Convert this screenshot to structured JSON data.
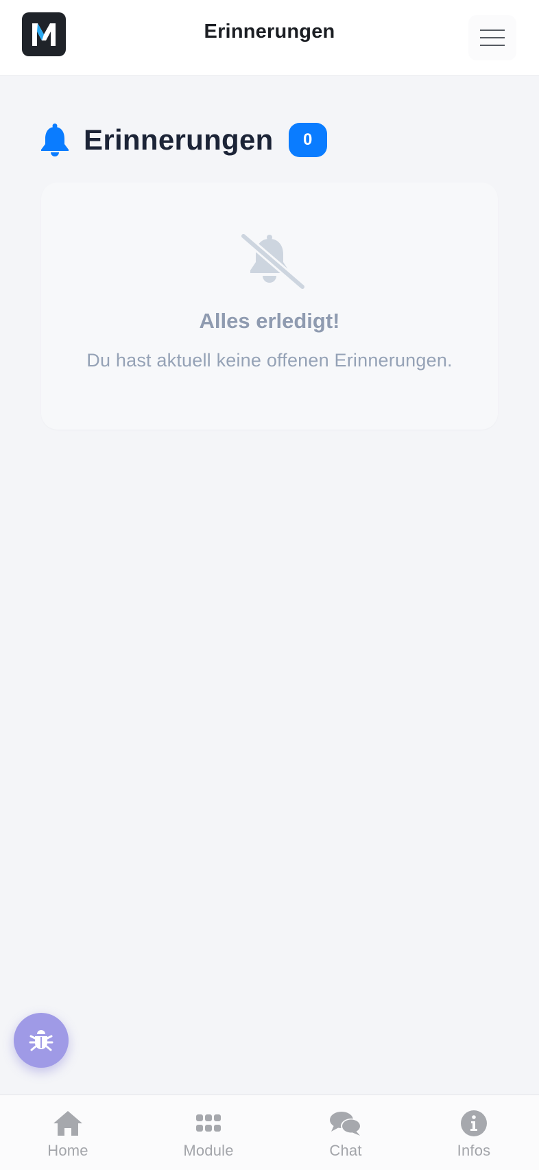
{
  "header": {
    "logo_letter": "M",
    "title": "Erinnerungen",
    "menu_icon": "hamburger-menu-icon"
  },
  "page": {
    "heading": "Erinnerungen",
    "heading_icon": "bell-icon",
    "count": "0",
    "accent_color": "#0a7cff"
  },
  "empty_state": {
    "icon": "bell-slash-icon",
    "title": "Alles erledigt!",
    "message": "Du hast aktuell keine offenen Erinnerungen."
  },
  "fab": {
    "icon": "bug-icon",
    "color": "#9f9ae6"
  },
  "bottom_nav": {
    "items": [
      {
        "label": "Home",
        "icon": "home-icon"
      },
      {
        "label": "Module",
        "icon": "grid-icon"
      },
      {
        "label": "Chat",
        "icon": "chat-bubbles-icon"
      },
      {
        "label": "Infos",
        "icon": "info-circle-icon"
      }
    ]
  }
}
